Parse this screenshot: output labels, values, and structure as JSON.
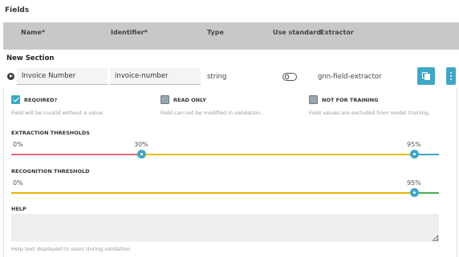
{
  "title": "Fields",
  "header": {
    "name": "Name*",
    "identifier": "Identifier*",
    "type": "Type",
    "use_standard": "Use standard",
    "extractor": "Extractor"
  },
  "section_title": "New Section",
  "field": {
    "name": "Invoice Number",
    "identifier": "invoice-number",
    "type": "string",
    "use_standard": false,
    "extractor": "gnn-field-extractor"
  },
  "options": {
    "required": {
      "label": "REQUIRED?",
      "checked": true,
      "desc": "Field will be invalid without a value."
    },
    "read_only": {
      "label": "READ ONLY",
      "checked": false,
      "desc": "Field can not be modified in validation."
    },
    "not_for_training": {
      "label": "NOT FOR TRAINING",
      "checked": false,
      "desc": "Field values are excluded from model training."
    }
  },
  "extraction_thresholds": {
    "label": "EXTRACTION THRESHOLDS",
    "ticks": [
      "0%",
      "30%",
      "95%"
    ],
    "values": [
      30,
      95
    ]
  },
  "recognition_threshold": {
    "label": "RECOGNITION THRESHOLD",
    "ticks": [
      "0%",
      "95%"
    ],
    "value": 95
  },
  "help": {
    "label": "HELP",
    "value": "",
    "note": "Help text displayed to users during validation"
  },
  "colors": {
    "accent": "#3fa7c6",
    "low": "#e06a7a",
    "mid": "#e8c200",
    "high": "#3fa7c6",
    "ok": "#4caf50"
  }
}
